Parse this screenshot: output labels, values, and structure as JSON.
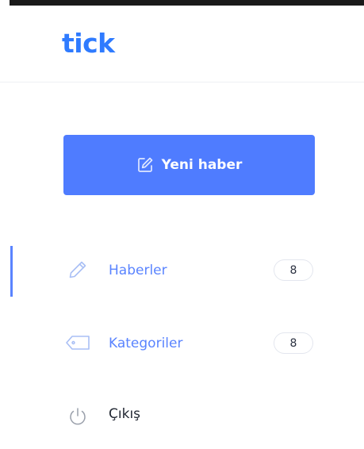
{
  "brand": {
    "logo_text": "tick",
    "accent": "#2f7bff"
  },
  "new_button": {
    "label": "Yeni haber",
    "icon": "edit-icon",
    "bg": "#4f7cff"
  },
  "nav": {
    "items": [
      {
        "label": "Haberler",
        "count": "8",
        "icon": "pencil-icon",
        "active": true
      },
      {
        "label": "Kategoriler",
        "count": "8",
        "icon": "tag-icon",
        "active": false
      },
      {
        "label": "Çıkış",
        "icon": "power-icon",
        "active": false
      }
    ]
  }
}
